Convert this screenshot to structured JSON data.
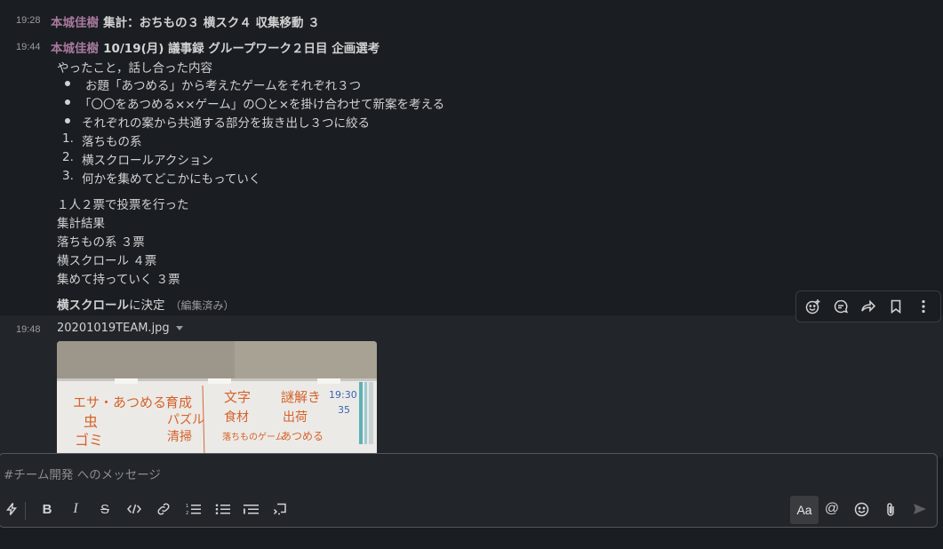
{
  "messages": [
    {
      "time": "19:28",
      "author": "本城佳樹",
      "text": "集計：おちもの３ 横スク４ 収集移動 ３"
    },
    {
      "time": "19:44",
      "author": "本城佳樹",
      "header": "10/19(月) 議事録 グループワーク２日目 企画選考",
      "intro": "やったこと，話し合った内容",
      "bullets": [
        "お題「あつめる」から考えたゲームをそれぞれ３つ",
        "「〇〇をあつめる××ゲーム」の〇と×を掛け合わせて新案を考える",
        "それぞれの案から共通する部分を抜き出し３つに絞る"
      ],
      "numbered": [
        {
          "num": "1.",
          "text": "落ちもの系"
        },
        {
          "num": "2.",
          "text": "横スクロールアクション"
        },
        {
          "num": "3.",
          "text": "何かを集めてどこかにもっていく"
        }
      ],
      "body": [
        "１人２票で投票を行った",
        "集計結果",
        "落ちもの系 ３票",
        "横スクロール ４票",
        "集めて持っていく ３票"
      ],
      "decision_bold": "横スクロール",
      "decision_rest": "に決定",
      "edited": "（編集済み）"
    },
    {
      "time": "19:48",
      "filename": "20201019TEAM.jpg",
      "whiteboard": {
        "col1": [
          "エサ・あつめる",
          "育成",
          "虫",
          "パズル",
          "ゴミ",
          "清掃"
        ],
        "col2": [
          "文字",
          "食材",
          "落ちものゲーム"
        ],
        "col3": [
          "謎解き",
          "出荷",
          "あつめる"
        ],
        "note_time": "19:30",
        "note_num": "35"
      }
    }
  ],
  "actions": [
    "add-reaction-icon",
    "reply-thread-icon",
    "share-icon",
    "bookmark-icon",
    "more-icon"
  ],
  "composer": {
    "placeholder": "#チーム開発 へのメッセージ",
    "format_label": "Aa"
  },
  "colors": {
    "background": "#1a1d21",
    "author": "#a8799f",
    "text": "#d1d2d3",
    "marker": "#d4622c"
  }
}
